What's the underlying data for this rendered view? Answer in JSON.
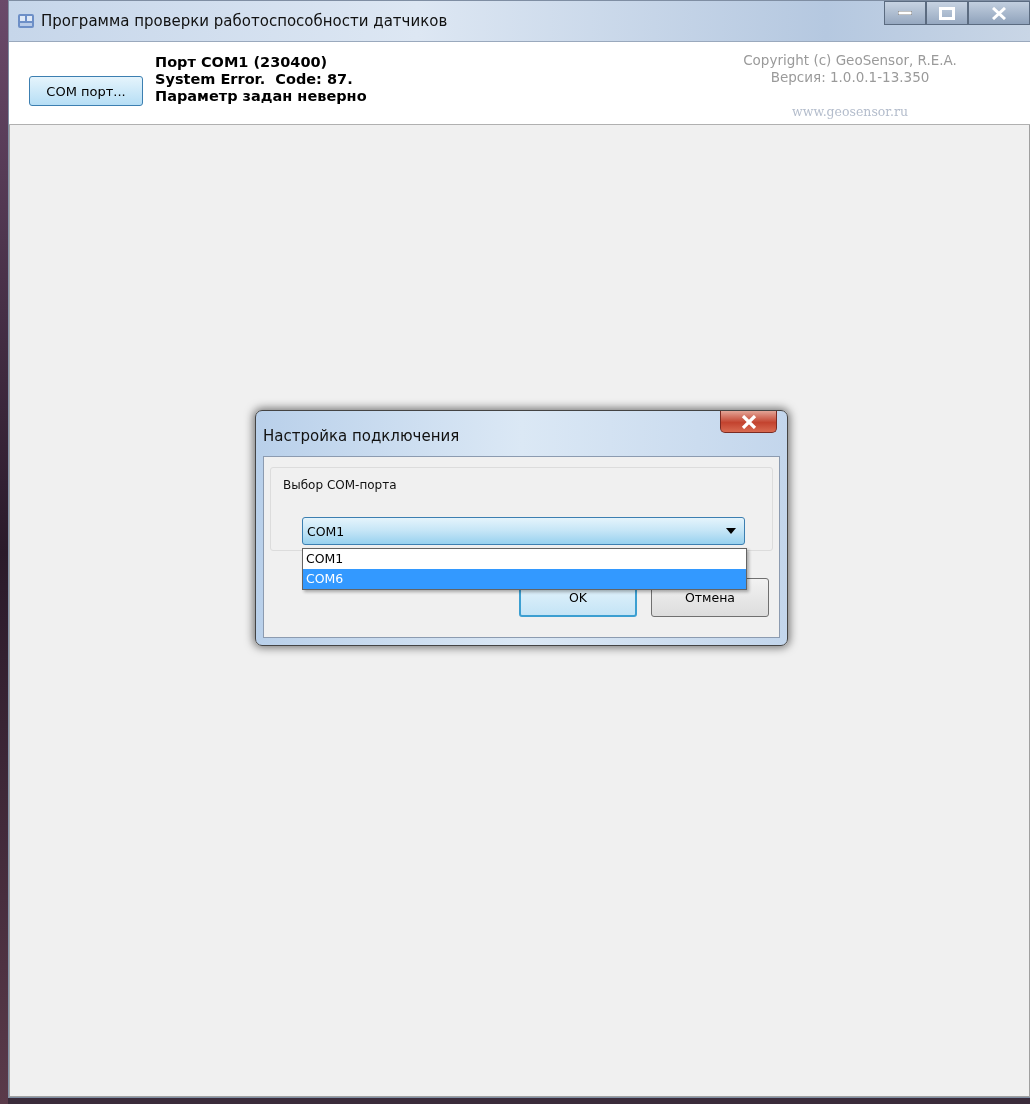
{
  "window": {
    "title": "Программа проверки работоспособности датчиков"
  },
  "header": {
    "port_button": "COM порт...",
    "status_lines": [
      "Порт COM1 (230400)",
      "System Error.  Code: 87.",
      "Параметр задан неверно"
    ],
    "copyright": "Copyright (c) GeoSensor, R.E.A.",
    "version": "Версия: 1.0.0.1-13.350",
    "website": "www.geosensor.ru"
  },
  "dialog": {
    "title": "Настройка подключения",
    "group_label": "Выбор COM-порта",
    "combo": {
      "value": "COM1",
      "expanded": true,
      "options": [
        {
          "label": "COM1",
          "highlighted": false
        },
        {
          "label": "COM6",
          "highlighted": true
        }
      ]
    },
    "buttons": [
      {
        "label": "OK",
        "default": true
      },
      {
        "label": "Отмена",
        "default": false
      }
    ]
  }
}
